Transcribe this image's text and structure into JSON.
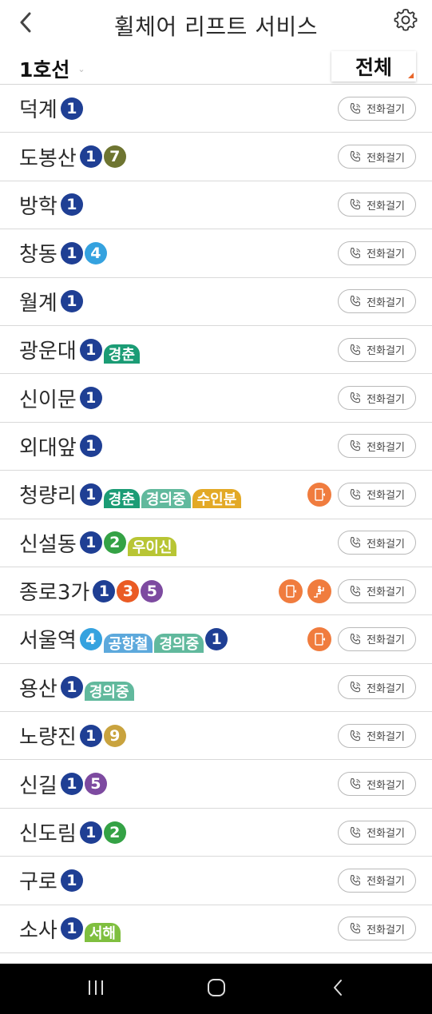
{
  "header": {
    "title": "휠체어 리프트 서비스"
  },
  "subbar": {
    "line": "1호선",
    "filter": "전체"
  },
  "call_label": "전화걸기",
  "colors": {
    "line1": "#1f3f94",
    "line2": "#34a245",
    "line3": "#ea5b24",
    "line4": "#35a2df",
    "line5": "#7d4aa0",
    "line7": "#6e7531",
    "line9": "#c9a33e",
    "gyeongchun": "#1b9c75",
    "gyeongui": "#61b99d",
    "suinbundang": "#e3a926",
    "uiSinseol": "#b8c534",
    "airport": "#5da9dc",
    "seohae": "#7fbf3f",
    "facility": "#f07c3e"
  },
  "stations": [
    {
      "name": "덕계",
      "badges": [
        {
          "label": "1",
          "color": "#1f3f94",
          "kind": "num"
        }
      ],
      "facilities": []
    },
    {
      "name": "도봉산",
      "badges": [
        {
          "label": "1",
          "color": "#1f3f94",
          "kind": "num"
        },
        {
          "label": "7",
          "color": "#6e7531",
          "kind": "num"
        }
      ],
      "facilities": []
    },
    {
      "name": "방학",
      "badges": [
        {
          "label": "1",
          "color": "#1f3f94",
          "kind": "num"
        }
      ],
      "facilities": []
    },
    {
      "name": "창동",
      "badges": [
        {
          "label": "1",
          "color": "#1f3f94",
          "kind": "num"
        },
        {
          "label": "4",
          "color": "#35a2df",
          "kind": "num"
        }
      ],
      "facilities": []
    },
    {
      "name": "월계",
      "badges": [
        {
          "label": "1",
          "color": "#1f3f94",
          "kind": "num"
        }
      ],
      "facilities": []
    },
    {
      "name": "광운대",
      "badges": [
        {
          "label": "1",
          "color": "#1f3f94",
          "kind": "num"
        },
        {
          "label": "경춘",
          "color": "#1b9c75",
          "kind": "txt"
        }
      ],
      "facilities": []
    },
    {
      "name": "신이문",
      "badges": [
        {
          "label": "1",
          "color": "#1f3f94",
          "kind": "num"
        }
      ],
      "facilities": []
    },
    {
      "name": "외대앞",
      "badges": [
        {
          "label": "1",
          "color": "#1f3f94",
          "kind": "num"
        }
      ],
      "facilities": []
    },
    {
      "name": "청량리",
      "badges": [
        {
          "label": "1",
          "color": "#1f3f94",
          "kind": "num"
        },
        {
          "label": "경춘",
          "color": "#1b9c75",
          "kind": "txt"
        },
        {
          "label": "경의중",
          "color": "#61b99d",
          "kind": "txt"
        },
        {
          "label": "수인분",
          "color": "#e3a926",
          "kind": "txt"
        }
      ],
      "facilities": [
        "elevator-icon"
      ]
    },
    {
      "name": "신설동",
      "badges": [
        {
          "label": "1",
          "color": "#1f3f94",
          "kind": "num"
        },
        {
          "label": "2",
          "color": "#34a245",
          "kind": "num"
        },
        {
          "label": "우이신",
          "color": "#b8c534",
          "kind": "txt"
        }
      ],
      "facilities": []
    },
    {
      "name": "종로3가",
      "badges": [
        {
          "label": "1",
          "color": "#1f3f94",
          "kind": "num"
        },
        {
          "label": "3",
          "color": "#ea5b24",
          "kind": "num"
        },
        {
          "label": "5",
          "color": "#7d4aa0",
          "kind": "num"
        }
      ],
      "facilities": [
        "elevator-icon",
        "stair-lift-icon"
      ]
    },
    {
      "name": "서울역",
      "badges": [
        {
          "label": "4",
          "color": "#35a2df",
          "kind": "num"
        },
        {
          "label": "공항철",
          "color": "#5da9dc",
          "kind": "txt"
        },
        {
          "label": "경의중",
          "color": "#61b99d",
          "kind": "txt"
        },
        {
          "label": "1",
          "color": "#1f3f94",
          "kind": "num"
        }
      ],
      "facilities": [
        "elevator-icon"
      ]
    },
    {
      "name": "용산",
      "badges": [
        {
          "label": "1",
          "color": "#1f3f94",
          "kind": "num"
        },
        {
          "label": "경의중",
          "color": "#61b99d",
          "kind": "txt"
        }
      ],
      "facilities": []
    },
    {
      "name": "노량진",
      "badges": [
        {
          "label": "1",
          "color": "#1f3f94",
          "kind": "num"
        },
        {
          "label": "9",
          "color": "#c9a33e",
          "kind": "num"
        }
      ],
      "facilities": []
    },
    {
      "name": "신길",
      "badges": [
        {
          "label": "1",
          "color": "#1f3f94",
          "kind": "num"
        },
        {
          "label": "5",
          "color": "#7d4aa0",
          "kind": "num"
        }
      ],
      "facilities": []
    },
    {
      "name": "신도림",
      "badges": [
        {
          "label": "1",
          "color": "#1f3f94",
          "kind": "num"
        },
        {
          "label": "2",
          "color": "#34a245",
          "kind": "num"
        }
      ],
      "facilities": []
    },
    {
      "name": "구로",
      "badges": [
        {
          "label": "1",
          "color": "#1f3f94",
          "kind": "num"
        }
      ],
      "facilities": []
    },
    {
      "name": "소사",
      "badges": [
        {
          "label": "1",
          "color": "#1f3f94",
          "kind": "num"
        },
        {
          "label": "서해",
          "color": "#7fbf3f",
          "kind": "txt"
        }
      ],
      "facilities": []
    }
  ],
  "navbar": {
    "icons": [
      "recent-apps-icon",
      "home-icon",
      "back-nav-icon"
    ]
  }
}
